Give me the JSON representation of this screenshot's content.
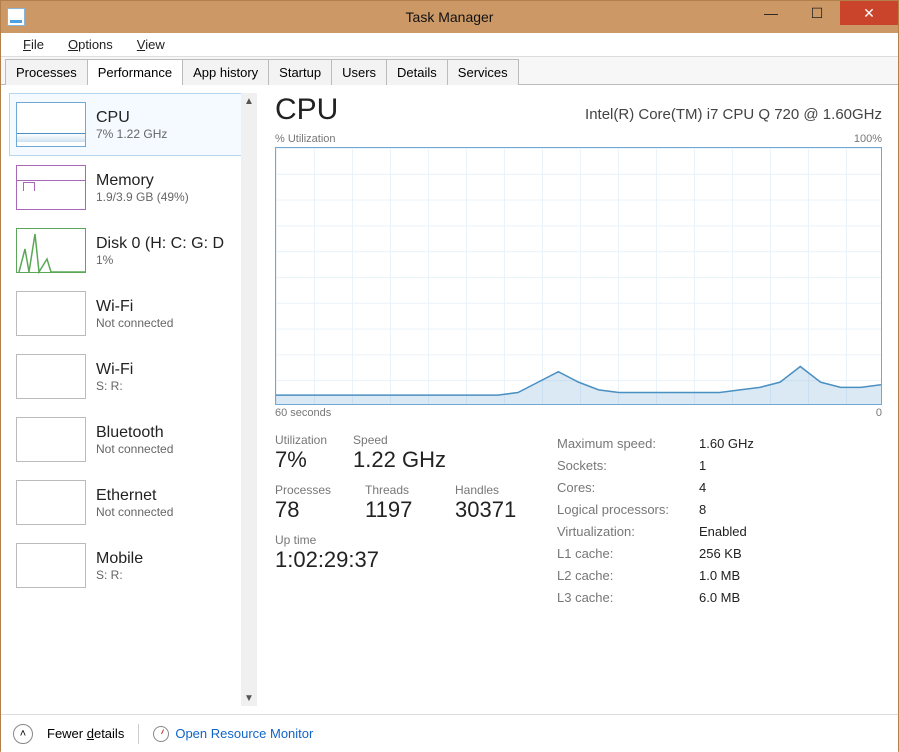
{
  "window": {
    "title": "Task Manager"
  },
  "window_buttons": {
    "minimize": "—",
    "maximize": "☐",
    "close": "✕"
  },
  "menu": {
    "file": "File",
    "options": "Options",
    "view": "View"
  },
  "tabs": [
    "Processes",
    "Performance",
    "App history",
    "Startup",
    "Users",
    "Details",
    "Services"
  ],
  "sidebar": [
    {
      "title": "CPU",
      "sub": "7% 1.22 GHz",
      "kind": "cpu",
      "selected": true
    },
    {
      "title": "Memory",
      "sub": "1.9/3.9 GB (49%)",
      "kind": "mem"
    },
    {
      "title": "Disk 0 (H: C: G: D",
      "sub": "1%",
      "kind": "disk"
    },
    {
      "title": "Wi-Fi",
      "sub": "Not connected",
      "kind": "gray"
    },
    {
      "title": "Wi-Fi",
      "sub": "S:  R:",
      "kind": "gray"
    },
    {
      "title": "Bluetooth",
      "sub": "Not connected",
      "kind": "gray"
    },
    {
      "title": "Ethernet",
      "sub": "Not connected",
      "kind": "gray"
    },
    {
      "title": "Mobile",
      "sub": "S:  R:",
      "kind": "gray"
    }
  ],
  "detail": {
    "title": "CPU",
    "device": "Intel(R) Core(TM) i7 CPU Q 720 @ 1.60GHz",
    "chart_top_left": "% Utilization",
    "chart_top_right": "100%",
    "chart_bot_left": "60 seconds",
    "chart_bot_right": "0",
    "big": {
      "util_label": "Utilization",
      "util_value": "7%",
      "speed_label": "Speed",
      "speed_value": "1.22 GHz",
      "proc_label": "Processes",
      "proc_value": "78",
      "threads_label": "Threads",
      "threads_value": "1197",
      "handles_label": "Handles",
      "handles_value": "30371",
      "uptime_label": "Up time",
      "uptime_value": "1:02:29:37"
    },
    "kv": [
      {
        "k": "Maximum speed:",
        "v": "1.60 GHz"
      },
      {
        "k": "Sockets:",
        "v": "1"
      },
      {
        "k": "Cores:",
        "v": "4"
      },
      {
        "k": "Logical processors:",
        "v": "8"
      },
      {
        "k": "Virtualization:",
        "v": "Enabled"
      },
      {
        "k": "L1 cache:",
        "v": "256 KB"
      },
      {
        "k": "L2 cache:",
        "v": "1.0 MB"
      },
      {
        "k": "L3 cache:",
        "v": "6.0 MB"
      }
    ]
  },
  "footer": {
    "fewer": "Fewer details",
    "resmon": "Open Resource Monitor"
  },
  "chart_data": {
    "type": "area",
    "title": "% Utilization",
    "ylabel": "% Utilization",
    "xlabel": "seconds",
    "ylim": [
      0,
      100
    ],
    "xrange_label": [
      "60 seconds",
      "0"
    ],
    "x": [
      0,
      2,
      4,
      6,
      8,
      10,
      12,
      14,
      16,
      18,
      20,
      22,
      24,
      26,
      28,
      30,
      32,
      34,
      36,
      38,
      40,
      42,
      44,
      46,
      48,
      50,
      52,
      54,
      56,
      58,
      60
    ],
    "values": [
      5,
      5,
      5,
      5,
      5,
      5,
      5,
      5,
      5,
      5,
      5,
      5,
      6,
      10,
      14,
      10,
      7,
      6,
      6,
      6,
      6,
      6,
      6,
      7,
      8,
      10,
      16,
      10,
      8,
      8,
      9
    ],
    "color": "#4a90c2"
  }
}
